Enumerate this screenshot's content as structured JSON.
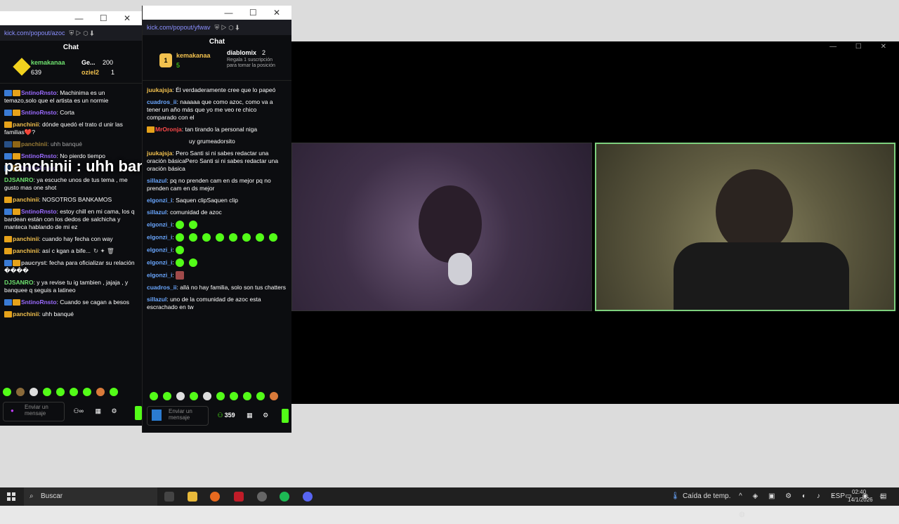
{
  "window1": {
    "url": "kick.com/popout/azoc",
    "chat_title": "Chat",
    "pinned": [
      {
        "name": "kemakanaa",
        "amount": "639"
      },
      {
        "name": "Ge...",
        "amount": "200"
      },
      {
        "name": "oziel2",
        "amount": "1"
      }
    ],
    "messages": [
      {
        "user": "SntinoRnsto",
        "text": ": Machinima es un temazo,solo que el artista es un normie"
      },
      {
        "user": "SntinoRnsto",
        "text": ": Corta"
      },
      {
        "user": "panchinii",
        "text": ": dónde quedó el trato d unir las familias❤️?"
      },
      {
        "user": "panchinii",
        "text": ": uhh banqué"
      },
      {
        "user": "SntinoRnsto",
        "text": ": No pierdo tiempo"
      },
      {
        "user": "SntinoRnsto",
        "text": ": W"
      },
      {
        "user": "DJSANRO",
        "text": ": ya escuche unos de tus tema , me gusto mas one shot"
      },
      {
        "user": "panchinii",
        "text": ": NOSOTROS BANKAMOS"
      },
      {
        "user": "SntinoRnsto",
        "text": ": estoy chill en mi cama, los q bardean están con los dedos de salchicha y manteca hablando de mi ez"
      },
      {
        "user": "panchinii",
        "text": ": cuando hay fecha con way"
      },
      {
        "user": "panchinii",
        "text": ": así c kgan a bife..."
      },
      {
        "user": "paucryst",
        "text": ": fecha para oficializar su relación ����"
      },
      {
        "user": "DJSANRO",
        "text": ": y ya revise tu ig tambien , jajaja , y banquee q seguis a latineo"
      },
      {
        "user": "SntinoRnsto",
        "text": ": Cuando se cagan a besos"
      },
      {
        "user": "panchinii",
        "text": ": uhh banqué"
      }
    ],
    "overlay_text": "panchinii : uhh banqué",
    "input_placeholder": "Enviar un mensaje"
  },
  "window2": {
    "url": "kick.com/popout/yfwav",
    "chat_title": "Chat",
    "pinned_name": "kemakanaa",
    "pinned_amount": "5",
    "gift_user": "diablomix",
    "gift_count": "2",
    "gift_text": "Regala 1 suscripción para tomar la posición",
    "messages": [
      {
        "user": "juukajsja",
        "text": ": Él verdaderamente cree que lo papeó"
      },
      {
        "user": "cuadros_ii",
        "text": ": naaaaa que como azoc, como va a tener un año más que yo me veo re chico comparado con el"
      },
      {
        "user": "MrOronja",
        "text": ": tan tirando la personal niga"
      },
      {
        "user": "",
        "text": "uy grumeadorsito"
      },
      {
        "user": "juukajsja",
        "text": ": Pero Santi si ni sabes redactar una oración básicaPero Santi si ni sabes redactar una oración básica"
      },
      {
        "user": "sillazul",
        "text": ": pq no prenden cam en ds mejor pq no prenden cam en ds mejor"
      },
      {
        "user": "elgonzi_i",
        "text": ": Saquen clipSaquen clip"
      },
      {
        "user": "sillazul",
        "text": ": comunidad de azoc"
      },
      {
        "user": "elgonzi_i",
        "text": ":"
      },
      {
        "user": "elgonzi_i",
        "text": ":"
      },
      {
        "user": "elgonzi_i",
        "text": ":"
      },
      {
        "user": "elgonzi_i",
        "text": ":"
      },
      {
        "user": "elgonzi_i",
        "text": ":"
      },
      {
        "user": "cuadros_ii",
        "text": ": allá no hay familia, solo son tus chatters"
      },
      {
        "user": "sillazul",
        "text": ": uno de la comunidad de azoc esta escrachado en tw"
      }
    ],
    "viewer_count": "359",
    "input_placeholder": "Enviar un mensaje"
  },
  "taskbar": {
    "search_label": "Buscar",
    "weather": "Caída de temp.",
    "lang": "ESP",
    "time": "02:40",
    "date": "14/1/2026"
  }
}
